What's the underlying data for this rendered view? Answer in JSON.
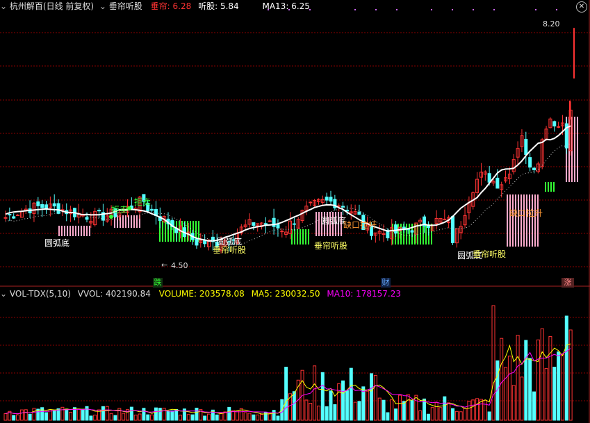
{
  "main_header": {
    "dropdown_icon": "chevron-down-icon",
    "stock_name": "杭州解百(日线 前复权)",
    "indicator_name": "垂帘听股",
    "chuilian_label": "垂帘:",
    "chuilian_value": "6.28",
    "tinggu_label": "听股:",
    "tinggu_value": "5.84",
    "ma13_label": "MA13:",
    "ma13_value": "6.25",
    "close_icon": "close-icon"
  },
  "price_axis": {
    "min": 4.3,
    "max": 8.4,
    "high_marker": "8.20",
    "low_marker": "4.50"
  },
  "signals": [
    {
      "text": "圆弧底",
      "color": "#ffffff"
    },
    {
      "text": "拒卖",
      "color": "#33ff33"
    },
    {
      "text": "拒卖",
      "color": "#33ff33"
    },
    {
      "text": "圆弧底",
      "color": "#ffffff"
    },
    {
      "text": "垂帘听股",
      "color": "#ffff66"
    },
    {
      "text": "圆弧底",
      "color": "#ffffff"
    },
    {
      "text": "垂帘听股",
      "color": "#ffff66"
    },
    {
      "text": "缺口拉杆",
      "color": "#ff9933"
    },
    {
      "text": "圆弧底",
      "color": "#ffffff"
    },
    {
      "text": "垂帘听股",
      "color": "#ffff66"
    },
    {
      "text": "缺口拉升",
      "color": "#ff9933"
    }
  ],
  "markers": {
    "die": "跌",
    "cai": "财",
    "zhang": "涨"
  },
  "vol_header": {
    "dropdown_icon": "chevron-down-icon",
    "name": "VOL-TDX(5,10)",
    "vvol_label": "VVOL:",
    "vvol_value": "402190.84",
    "volume_label": "VOLUME:",
    "volume_value": "203578.08",
    "ma5_label": "MA5:",
    "ma5_value": "230032.50",
    "ma10_label": "MA10:",
    "ma10_value": "178157.23"
  },
  "colors": {
    "up": "#ff3333",
    "down": "#54ffff",
    "ma13": "#ffffff",
    "volume": "#ffff00",
    "ma10": "#ff00ff",
    "grid": "#8b0000",
    "green_zone": "#33ff33",
    "pink_zone": "#ffaacc"
  }
}
